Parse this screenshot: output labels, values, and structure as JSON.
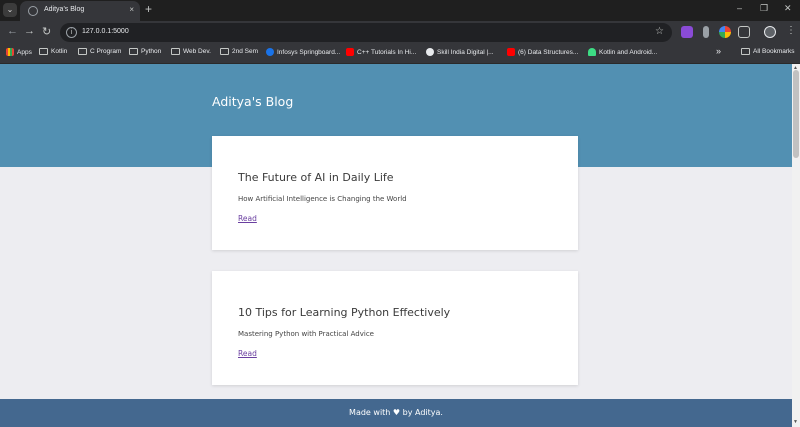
{
  "browser": {
    "tab_title": "Aditya's Blog",
    "tab_close": "×",
    "new_tab": "+",
    "url": "127.0.0.1:5000",
    "window_minimize": "–",
    "window_maximize": "❐",
    "window_close": "✕",
    "bookmarks": [
      {
        "label": "Apps",
        "icon": "apps-grid-icon"
      },
      {
        "label": "Kotlin",
        "icon": "folder-icon"
      },
      {
        "label": "C Program",
        "icon": "folder-icon"
      },
      {
        "label": "Python",
        "icon": "folder-icon"
      },
      {
        "label": "Web Dev.",
        "icon": "folder-icon"
      },
      {
        "label": "2nd Sem",
        "icon": "folder-icon"
      },
      {
        "label": "Infosys Springboard...",
        "icon": "infosys-icon"
      },
      {
        "label": "C++ Tutorials In Hi...",
        "icon": "youtube-icon"
      },
      {
        "label": "Skill India Digital |...",
        "icon": "skill-india-icon"
      },
      {
        "label": "(6) Data Structures...",
        "icon": "youtube-icon"
      },
      {
        "label": "Kotlin and Android...",
        "icon": "android-icon"
      }
    ],
    "more_bookmarks": "»",
    "all_bookmarks": "All Bookmarks"
  },
  "site": {
    "title": "Aditya's Blog"
  },
  "posts": [
    {
      "title": "The Future of AI in Daily Life",
      "subtitle": "How Artificial Intelligence is Changing the World",
      "link": "Read"
    },
    {
      "title": "10 Tips for Learning Python Effectively",
      "subtitle": "Mastering Python with Practical Advice",
      "link": "Read"
    }
  ],
  "footer": {
    "text": "Made with ♥ by Aditya."
  },
  "colors": {
    "header": "#5290b2",
    "footer": "#44688f",
    "page_bg": "#ededf1",
    "link": "#6a3fa0"
  }
}
